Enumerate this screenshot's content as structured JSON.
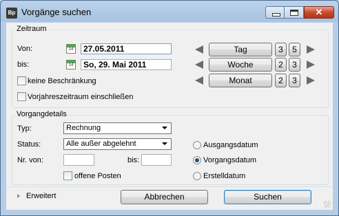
{
  "window": {
    "title": "Vorgänge suchen",
    "app_icon_text": "Bp",
    "close_glyph": "✕"
  },
  "zeitraum": {
    "group_title": "Zeitraum",
    "von_label": "Von:",
    "von_value": "27.05.2011",
    "bis_label": "bis:",
    "bis_value": "So, 29. Mai 2011",
    "calendar_day": "14",
    "keine_beschraenkung": "keine Beschränkung",
    "vorjahr": "Vorjahreszeitraum einschließen",
    "steps": [
      {
        "label": "Tag",
        "a": "3",
        "b": "5"
      },
      {
        "label": "Woche",
        "a": "2",
        "b": "3"
      },
      {
        "label": "Monat",
        "a": "2",
        "b": "3"
      }
    ]
  },
  "vorgangsdetails": {
    "group_title": "Vorgangdetails",
    "typ_label": "Typ:",
    "typ_value": "Rechnung",
    "status_label": "Status:",
    "status_value": "Alle außer abgelehnt",
    "nr_von_label": "Nr. von:",
    "bis_label": "bis:",
    "offene_posten": "offene Posten",
    "radios": [
      {
        "label": "Ausgangsdatum",
        "checked": false
      },
      {
        "label": "Vorgangsdatum",
        "checked": true
      },
      {
        "label": "Erstelldatum",
        "checked": false
      }
    ]
  },
  "footer": {
    "erweitert": "Erweitert",
    "abbrechen": "Abbrechen",
    "suchen": "Suchen"
  }
}
